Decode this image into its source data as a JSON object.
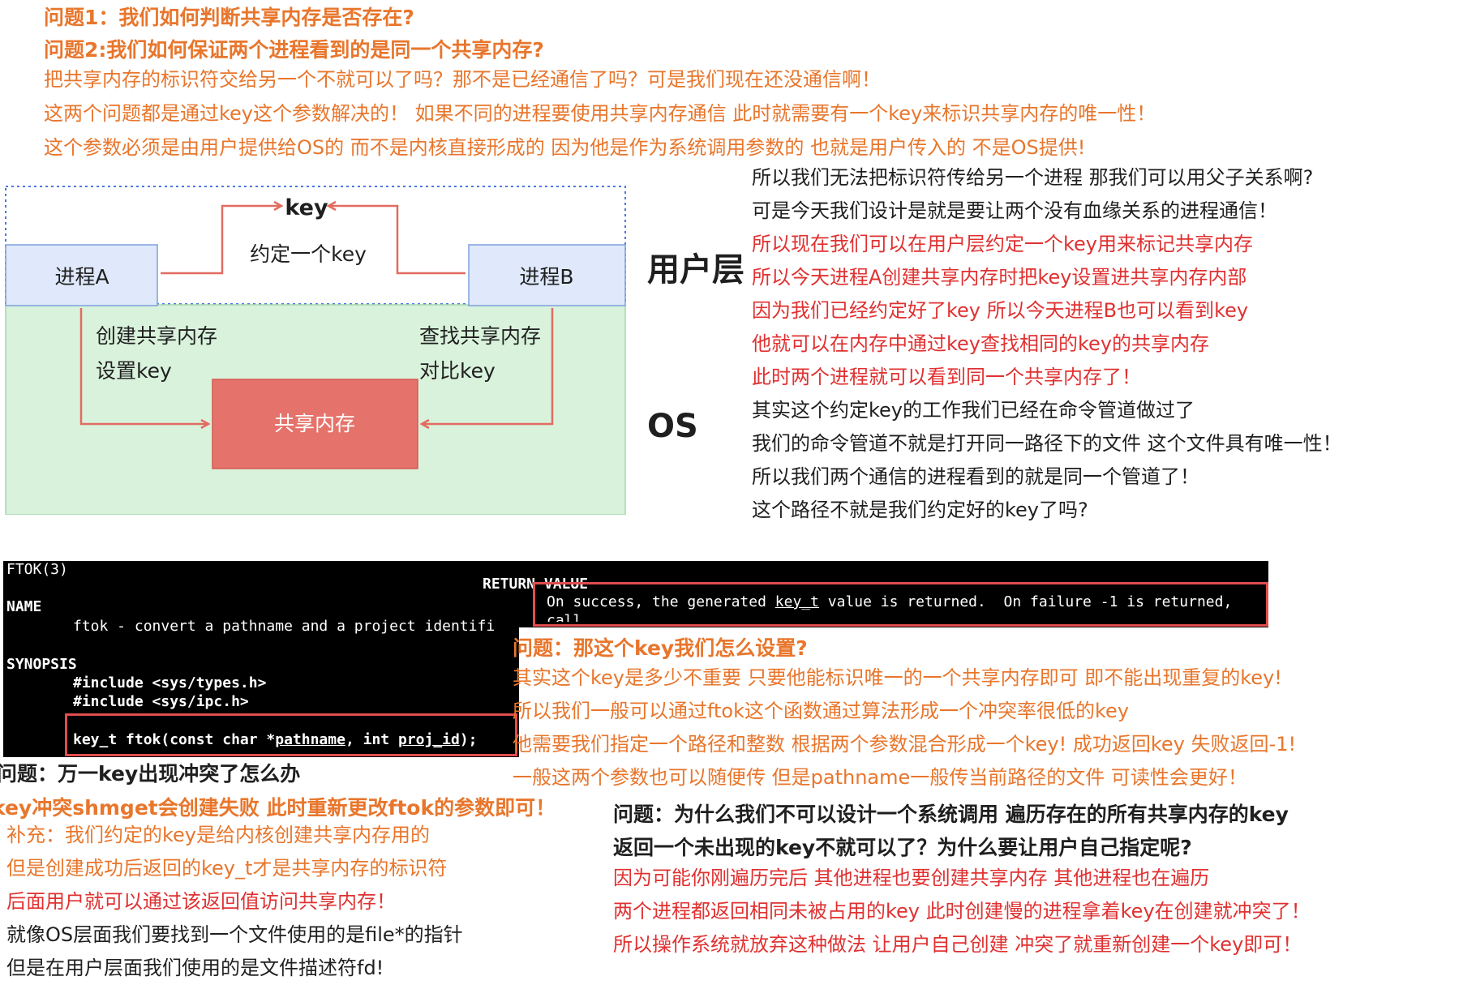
{
  "top": {
    "q1": "问题1：我们如何判断共享内存是否存在?",
    "q2": "问题2:我们如何保证两个进程看到的是同一个共享内存?",
    "l1": "把共享内存的标识符交给另一个不就可以了吗？那不是已经通信了吗？可是我们现在还没通信啊！",
    "l2": "这两个问题都是通过key这个参数解决的！ 如果不同的进程要使用共享内存通信 此时就需要有一个key来标识共享内存的唯一性！",
    "l3": "这个参数必须是由用户提供给OS的 而不是内核直接形成的 因为他是作为系统调用参数的 也就是用户传入的 不是OS提供!"
  },
  "diagram": {
    "key": "key",
    "agree": "约定一个key",
    "proc_a": "进程A",
    "proc_b": "进程B",
    "create_1": "创建共享内存",
    "create_2": "设置key",
    "find_1": "查找共享内存",
    "find_2": "对比key",
    "shm": "共享内存"
  },
  "layers": {
    "user": "用户层",
    "os": "OS"
  },
  "right_notes": [
    {
      "text": "所以我们无法把标识符传给另一个进程 那我们可以用父子关系啊?",
      "color": "dark"
    },
    {
      "text": "可是今天我们设计是就是要让两个没有血缘关系的进程通信！",
      "color": "dark"
    },
    {
      "text": "所以现在我们可以在用户层约定一个key用来标记共享内存",
      "color": "red"
    },
    {
      "text": "所以今天进程A创建共享内存时把key设置进共享内存内部",
      "color": "red"
    },
    {
      "text": "因为我们已经约定好了key 所以今天进程B也可以看到key",
      "color": "red"
    },
    {
      "text": "他就可以在内存中通过key查找相同的key的共享内存",
      "color": "red"
    },
    {
      "text": "此时两个进程就可以看到同一个共享内存了！",
      "color": "red"
    },
    {
      "text": "其实这个约定key的工作我们已经在命令管道做过了",
      "color": "dark"
    },
    {
      "text": "我们的命令管道不就是打开同一路径下的文件 这个文件具有唯一性！",
      "color": "dark"
    },
    {
      "text": "所以我们两个通信的进程看到的就是同一个管道了！",
      "color": "dark"
    },
    {
      "text": "这个路径不就是我们约定好的key了吗?",
      "color": "dark"
    }
  ],
  "man": {
    "title": "FTOK(3)",
    "name_hdr": "NAME",
    "name_line": "ftok - convert a pathname and a project identifi",
    "syn_hdr": "SYNOPSIS",
    "inc1": "#include <sys/types.h>",
    "inc2": "#include <sys/ipc.h>",
    "proto_a": "key_t ftok(const char *",
    "proto_b": "pathname",
    "proto_c": ", int ",
    "proto_d": "proj_id",
    "proto_e": ");",
    "ret_hdr": "RETURN VALUE",
    "ret_a": "On success, the generated ",
    "ret_b": "key_t",
    "ret_c": " value is returned.  On failure -1 is returned,",
    "ret_cut": "call"
  },
  "mid_right": {
    "q": "问题：那这个key我们怎么设置?",
    "l1": "其实这个key是多少不重要 只要他能标识唯一的一个共享内存即可 即不能出现重复的key!",
    "l2": "所以我们一般可以通过ftok这个函数通过算法形成一个冲突率很低的key",
    "l3": "他需要我们指定一个路径和整数 根据两个参数混合形成一个key! 成功返回key 失败返回-1!",
    "l4": "一般这两个参数也可以随便传 但是pathname一般传当前路径的文件 可读性会更好！"
  },
  "bottom_left": {
    "q": "问题：万一key出现冲突了怎么办",
    "a": "key冲突shmget会创建失败 此时重新更改ftok的参数即可！",
    "s1": "补充：我们约定的key是给内核创建共享内存用的",
    "s2": "但是创建成功后返回的key_t才是共享内存的标识符",
    "s3": "后面用户就可以通过该返回值访问共享内存！",
    "s4": "就像OS层面我们要找到一个文件使用的是file*的指针",
    "s5": "但是在用户层面我们使用的是文件描述符fd!"
  },
  "bottom_right": {
    "q1": "问题：为什么我们不可以设计一个系统调用 遍历存在的所有共享内存的key",
    "q2": "返回一个未出现的key不就可以了？为什么要让用户自己指定呢?",
    "a1": "因为可能你刚遍历完后 其他进程也要创建共享内存 其他进程也在遍历",
    "a2": "两个进程都返回相同未被占用的key 此时创建慢的进程拿着key在创建就冲突了！",
    "a3": "所以操作系统就放弃这种做法 让用户自己创建 冲突了就重新创建一个key即可！"
  },
  "colors": {
    "orange": "#e8762c",
    "red": "#e03131",
    "dark": "#1f1f1f",
    "process_fill": "#dfe9fb",
    "os_fill": "#d9f2dc",
    "shm_fill": "#e5736b",
    "arrow": "#e26b60"
  }
}
